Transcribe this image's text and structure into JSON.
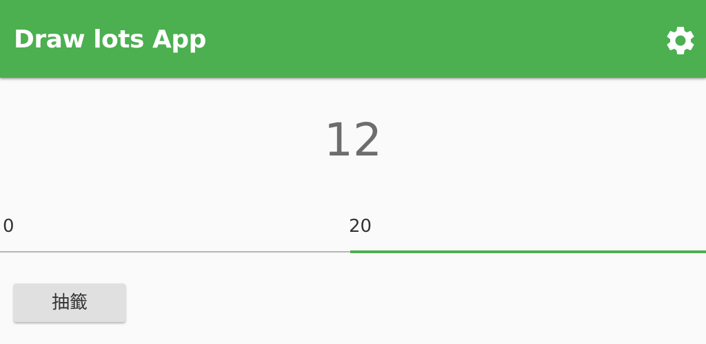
{
  "app": {
    "title": "Draw lots App"
  },
  "toolbar": {
    "background_color": "#4caf50",
    "settings_icon": "gear-icon"
  },
  "result": {
    "value": "12"
  },
  "range": {
    "min_label": "0",
    "max_label": "20",
    "accent_color": "#4caf50"
  },
  "actions": {
    "draw_label": "抽籤"
  }
}
